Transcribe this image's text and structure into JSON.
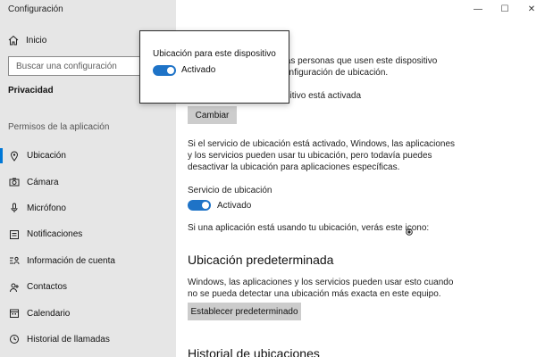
{
  "window": {
    "title": "Configuración",
    "controls": {
      "minimize": "—",
      "maximize": "☐",
      "close": "✕"
    }
  },
  "sidebar": {
    "home_label": "Inicio",
    "search_placeholder": "Buscar una configuración",
    "section_title": "Privacidad",
    "group_header": "Permisos de la aplicación",
    "items": [
      {
        "label": "Ubicación",
        "icon": "location-icon",
        "active": true
      },
      {
        "label": "Cámara",
        "icon": "camera-icon"
      },
      {
        "label": "Micrófono",
        "icon": "microphone-icon"
      },
      {
        "label": "Notificaciones",
        "icon": "notifications-icon"
      },
      {
        "label": "Información de cuenta",
        "icon": "account-info-icon"
      },
      {
        "label": "Contactos",
        "icon": "contacts-icon"
      },
      {
        "label": "Calendario",
        "icon": "calendar-icon"
      },
      {
        "label": "Historial de llamadas",
        "icon": "call-history-icon"
      }
    ]
  },
  "popup": {
    "title": "Ubicación para este dispositivo",
    "toggle_state": "Activado"
  },
  "content": {
    "intro_line1": ", las personas que usen este dispositivo",
    "intro_line2": "onfiguración de ubicación.",
    "device_status": "ositivo está activada",
    "change_button": "Cambiar",
    "service_desc_line1": "Si el servicio de ubicación está activado, Windows, las aplicaciones",
    "service_desc_line2": "y los servicios pueden usar tu ubicación, pero todavía puedes",
    "service_desc_line3": "desactivar la ubicación para aplicaciones específicas.",
    "service_label": "Servicio de ubicación",
    "service_toggle_state": "Activado",
    "icon_note": "Si una aplicación está usando tu ubicación, verás este icono:",
    "default_title": "Ubicación predeterminada",
    "default_desc_line1": "Windows, las aplicaciones y los servicios pueden usar esto cuando",
    "default_desc_line2": "no se pueda detectar una ubicación más exacta en este equipo.",
    "default_button": "Establecer predeterminado",
    "history_title": "Historial de ubicaciones"
  },
  "colors": {
    "accent": "#0078d7",
    "toggle_on": "#1e73c7",
    "sidebar_bg": "#e6e6e6"
  }
}
